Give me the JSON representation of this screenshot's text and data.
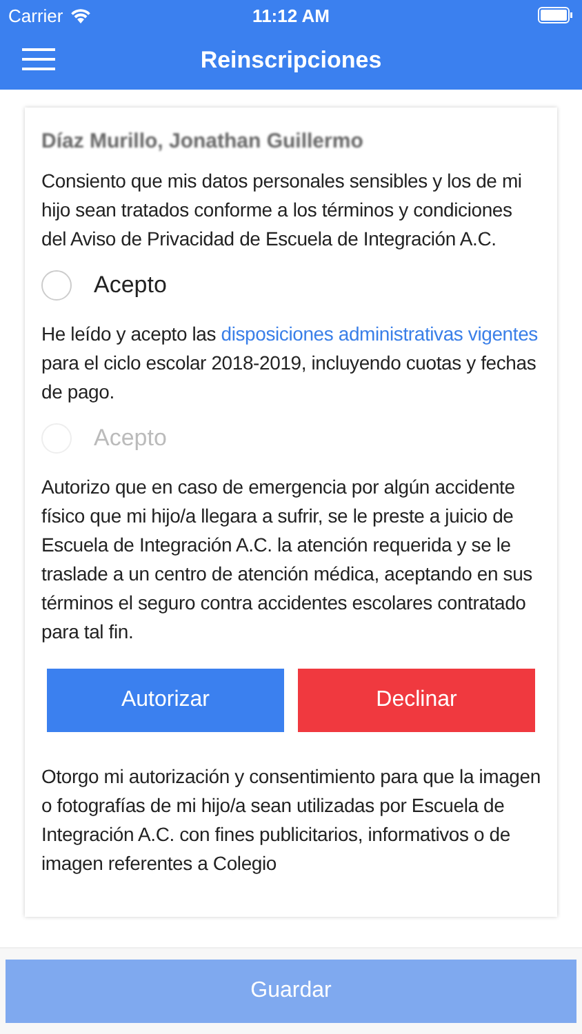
{
  "status_bar": {
    "carrier": "Carrier",
    "time": "11:12 AM"
  },
  "header": {
    "title": "Reinscripciones"
  },
  "student_name": "Díaz Murillo, Jonathan Guillermo",
  "sections": [
    {
      "kind": "paragraph",
      "text": "Consiento que mis datos personales sensibles y los de mi hijo sean tratados conforme a los términos y condiciones del Aviso de Privacidad de Escuela de Integración A.C."
    },
    {
      "kind": "radio",
      "label": "Acepto",
      "selected": false,
      "disabled": false
    },
    {
      "kind": "paragraph",
      "text": "He leído y acepto las ",
      "link": "disposiciones administrativas vigentes",
      "after": " para el ciclo escolar 2018-2019, incluyendo cuotas y fechas de pago."
    },
    {
      "kind": "radio",
      "label": "Acepto",
      "selected": false,
      "disabled": true
    },
    {
      "kind": "paragraph",
      "text": "Autorizo que en caso de emergencia por algún accidente físico que mi hijo/a llegara a sufrir, se le preste a juicio de Escuela de Integración A.C. la atención requerida y se le traslade a un centro de atención médica, aceptando en sus términos el seguro contra accidentes escolares contratado para tal fin."
    },
    {
      "kind": "buttons",
      "accept": "Autorizar",
      "decline": "Declinar"
    },
    {
      "kind": "paragraph",
      "text": "Otorgo mi autorización y consentimiento para que la imagen o fotografías de mi hijo/a sean utilizadas por Escuela de Integración A.C. con fines publicitarios, informativos o de imagen referentes a Colegio"
    }
  ],
  "footer": {
    "button": "Guardar",
    "disabled": true
  }
}
